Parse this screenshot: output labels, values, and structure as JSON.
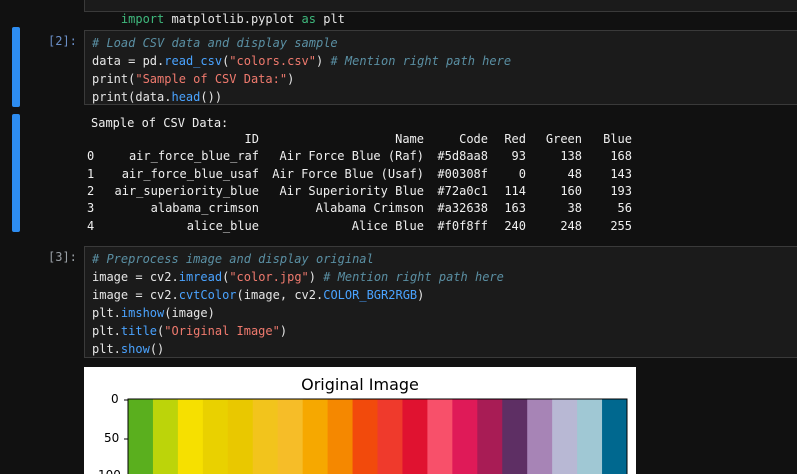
{
  "cells": {
    "top_partial": {
      "code": [
        "import matplotlib.pyplot as plt"
      ]
    },
    "cell2": {
      "prompt": "[2]:",
      "lines": [
        [
          {
            "t": "# Load CSV data and display sample",
            "c": "comment"
          }
        ],
        [
          {
            "t": "data ",
            "c": "plain"
          },
          {
            "t": "=",
            "c": "plain"
          },
          {
            "t": " pd.",
            "c": "plain"
          },
          {
            "t": "read_csv",
            "c": "fn"
          },
          {
            "t": "(",
            "c": "plain"
          },
          {
            "t": "\"colors.csv\"",
            "c": "str"
          },
          {
            "t": ") ",
            "c": "plain"
          },
          {
            "t": "# Mention right path here",
            "c": "comment"
          }
        ],
        [
          {
            "t": "print",
            "c": "plain"
          },
          {
            "t": "(",
            "c": "plain"
          },
          {
            "t": "\"Sample of CSV Data:\"",
            "c": "str"
          },
          {
            "t": ")",
            "c": "plain"
          }
        ],
        [
          {
            "t": "print",
            "c": "plain"
          },
          {
            "t": "(data.",
            "c": "plain"
          },
          {
            "t": "head",
            "c": "fn"
          },
          {
            "t": "())",
            "c": "plain"
          }
        ]
      ]
    },
    "output2": {
      "header_text": "Sample of CSV Data:",
      "columns": [
        "",
        "ID",
        "Name",
        "Code",
        "Red",
        "Green",
        "Blue"
      ],
      "rows": [
        [
          "0",
          "air_force_blue_raf",
          "Air Force Blue (Raf)",
          "#5d8aa8",
          "93",
          "138",
          "168"
        ],
        [
          "1",
          "air_force_blue_usaf",
          "Air Force Blue (Usaf)",
          "#00308f",
          "0",
          "48",
          "143"
        ],
        [
          "2",
          "air_superiority_blue",
          "Air Superiority Blue",
          "#72a0c1",
          "114",
          "160",
          "193"
        ],
        [
          "3",
          "alabama_crimson",
          "Alabama Crimson",
          "#a32638",
          "163",
          "38",
          "56"
        ],
        [
          "4",
          "alice_blue",
          "Alice Blue",
          "#f0f8ff",
          "240",
          "248",
          "255"
        ]
      ]
    },
    "cell3": {
      "prompt": "[3]:",
      "lines": [
        [
          {
            "t": "# Preprocess image and display original",
            "c": "comment"
          }
        ],
        [
          {
            "t": "image ",
            "c": "plain"
          },
          {
            "t": "=",
            "c": "plain"
          },
          {
            "t": " cv2.",
            "c": "plain"
          },
          {
            "t": "imread",
            "c": "fn"
          },
          {
            "t": "(",
            "c": "plain"
          },
          {
            "t": "\"color.jpg\"",
            "c": "str"
          },
          {
            "t": ") ",
            "c": "plain"
          },
          {
            "t": "# Mention right path here",
            "c": "comment"
          }
        ],
        [
          {
            "t": "image ",
            "c": "plain"
          },
          {
            "t": "=",
            "c": "plain"
          },
          {
            "t": " cv2.",
            "c": "plain"
          },
          {
            "t": "cvtColor",
            "c": "fn"
          },
          {
            "t": "(image, cv2.",
            "c": "plain"
          },
          {
            "t": "COLOR_BGR2RGB",
            "c": "fn"
          },
          {
            "t": ")",
            "c": "plain"
          }
        ],
        [
          {
            "t": "plt.",
            "c": "plain"
          },
          {
            "t": "imshow",
            "c": "fn"
          },
          {
            "t": "(image)",
            "c": "plain"
          }
        ],
        [
          {
            "t": "plt.",
            "c": "plain"
          },
          {
            "t": "title",
            "c": "fn"
          },
          {
            "t": "(",
            "c": "plain"
          },
          {
            "t": "\"Original Image\"",
            "c": "str"
          },
          {
            "t": ")",
            "c": "plain"
          }
        ],
        [
          {
            "t": "plt.",
            "c": "plain"
          },
          {
            "t": "show",
            "c": "fn"
          },
          {
            "t": "()",
            "c": "plain"
          }
        ]
      ]
    }
  },
  "figure": {
    "title": "Original Image",
    "y_ticks": [
      "0",
      "50",
      "100"
    ],
    "stripes": [
      "#5aaf1e",
      "#bcd40a",
      "#f6e000",
      "#e9d100",
      "#e9c800",
      "#f2c41c",
      "#f6bd28",
      "#f6a800",
      "#f58800",
      "#f24a0c",
      "#ef3a2c",
      "#e01230",
      "#f8506a",
      "#df1a58",
      "#a81c55",
      "#5e2f64",
      "#a784b6",
      "#b8b8d4",
      "#a0c8d4",
      "#00688f"
    ]
  },
  "theme": {
    "accent": "#2d8cf0",
    "background": "#111111"
  }
}
